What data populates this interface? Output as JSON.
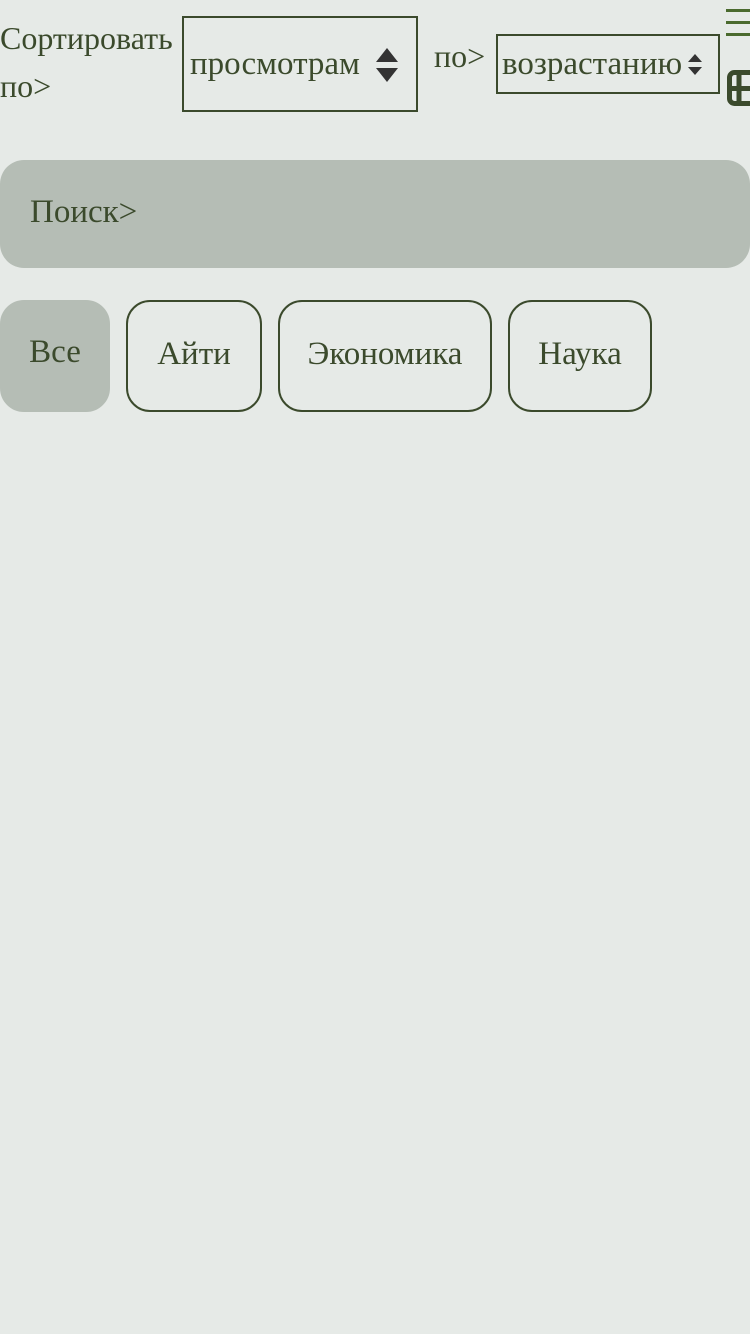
{
  "sort": {
    "label": "Сортировать по>",
    "field_value": "просмотрам",
    "order_label": "по>",
    "order_value": "возрастанию"
  },
  "view_icons": {
    "list": "list-view-icon",
    "grid": "grid-view-icon"
  },
  "search": {
    "placeholder": "Поиск>"
  },
  "categories": [
    {
      "label": "Все",
      "active": true
    },
    {
      "label": "Айти",
      "active": false
    },
    {
      "label": "Экономика",
      "active": false
    },
    {
      "label": "Наука",
      "active": false
    }
  ],
  "colors": {
    "background": "#e6eae7",
    "accent": "#3b4a2c",
    "muted_fill": "#b5bdb5"
  }
}
